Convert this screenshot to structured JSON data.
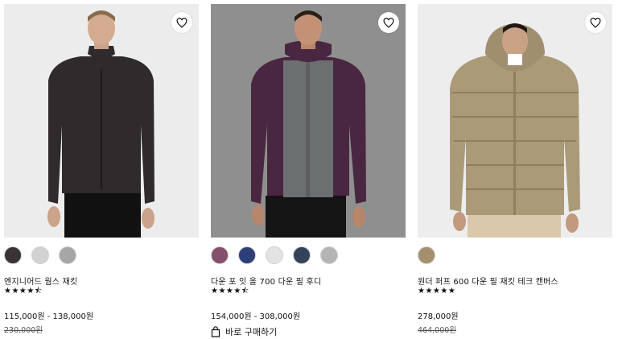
{
  "products": [
    {
      "name": "엔지니어드 웜스 재킷",
      "stars_text": "★★★★⯪",
      "price_range": "115,000원 - 138,000원",
      "original_price": "230,000원",
      "swatch_colors": [
        "#3b3234",
        "#d2d2d2",
        "#a6a6a6"
      ]
    },
    {
      "name": "다운 포 잇 올 700 다운 필 후디",
      "stars_text": "★★★★⯪",
      "price_range": "154,000원 - 308,000원",
      "quick_buy_label": "바로 구매하기",
      "swatch_colors": [
        "#84506c",
        "#2d3f78",
        "#e3e3e3",
        "#34435a",
        "#b4b4b4"
      ]
    },
    {
      "name": "원더 퍼프 600 다운 필 재킷 테크 캔버스",
      "stars_text": "★★★★★",
      "price_range": "278,000원",
      "original_price": "464,000원",
      "swatch_colors": [
        "#a68f6d"
      ]
    }
  ],
  "icons": {
    "wishlist": "heart-outline-icon",
    "quick_buy": "shopping-bag-icon"
  },
  "colors": {
    "background": "#ffffff",
    "text": "#111111",
    "photo_bg_1": "#ececec",
    "photo_bg_2": "#8f8f8f",
    "photo_bg_3": "#ededed"
  }
}
